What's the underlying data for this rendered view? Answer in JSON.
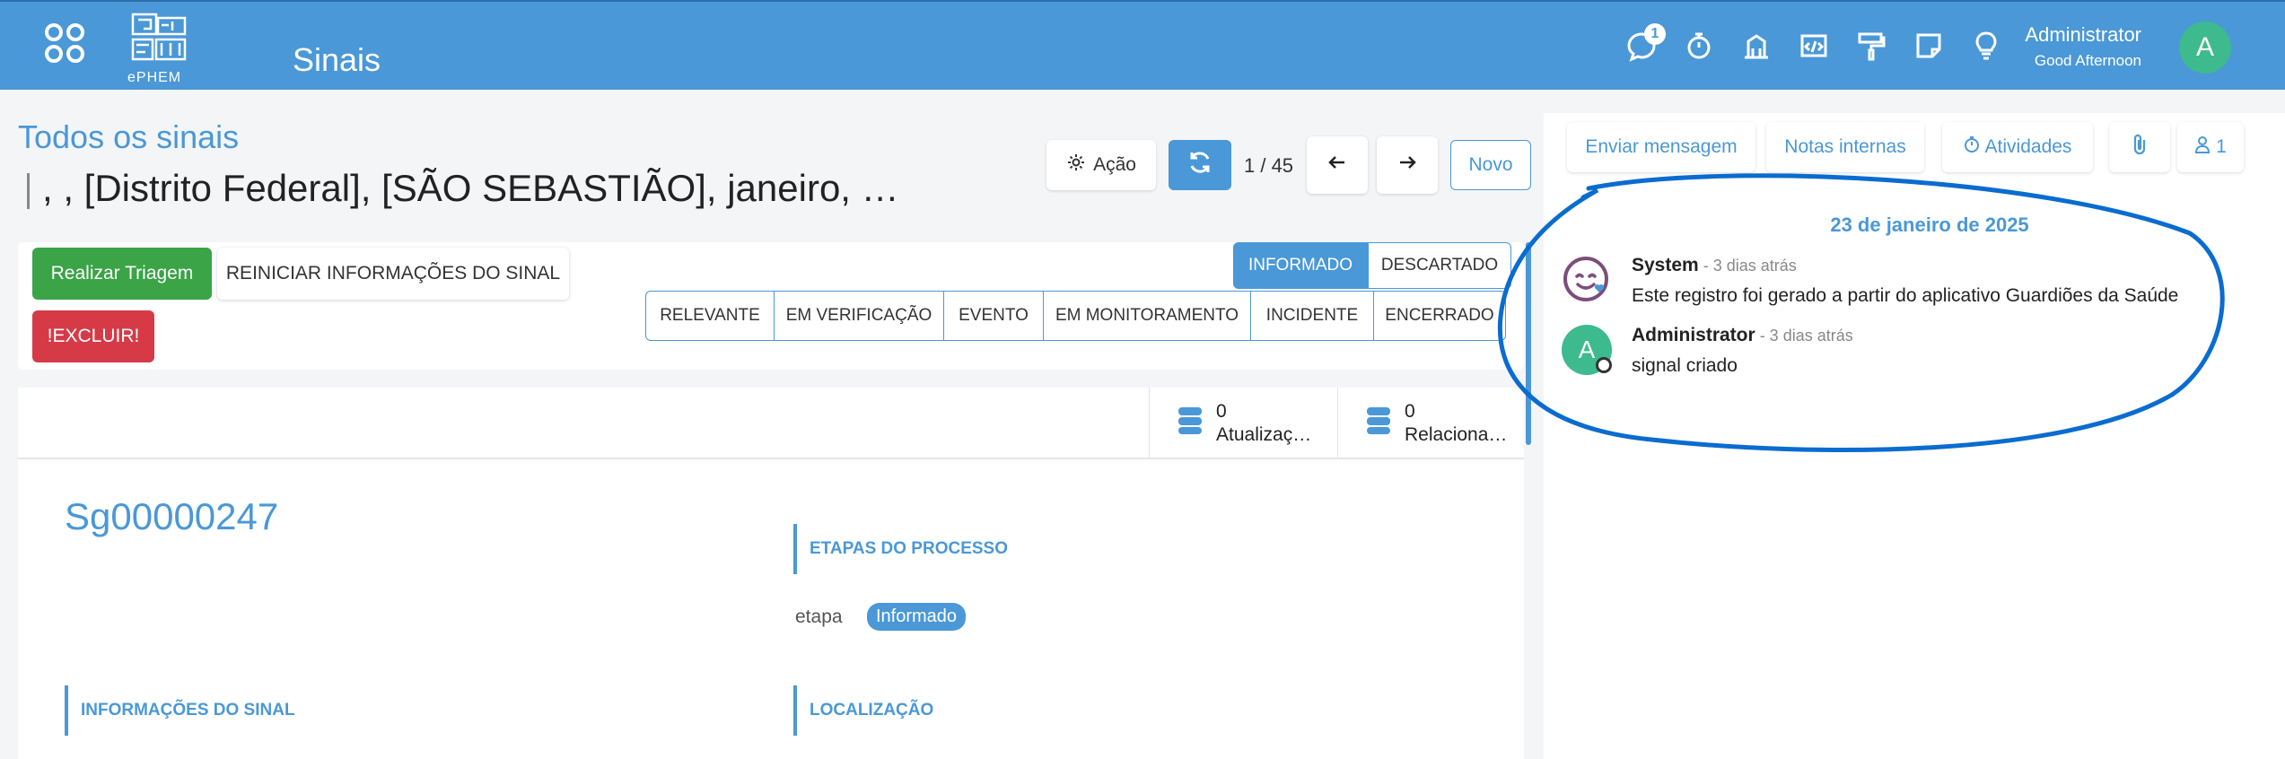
{
  "navbar": {
    "app_title": "Sinais",
    "logo_text": "ePHEM",
    "message_badge": "1",
    "user_name": "Administrator",
    "user_greeting": "Good Afternoon",
    "user_initial": "A",
    "icons": [
      "messages-icon",
      "stopwatch-icon",
      "building-icon",
      "code-window-icon",
      "paint-roller-icon",
      "note-icon",
      "lightbulb-icon"
    ]
  },
  "control": {
    "breadcrumb": "Todos os sinais",
    "record_title": ", , [Distrito Federal], [SÃO SEBASTIÃO], janeiro, …",
    "action_label": "Ação",
    "pager": "1 / 45",
    "new_label": "Novo"
  },
  "form": {
    "triage_label": "Realizar Triagem",
    "reset_label": "REINICIAR INFORMAÇÕES DO SINAL",
    "delete_label": "!EXCLUIR!",
    "status_top": [
      {
        "label": "INFORMADO",
        "active": true
      },
      {
        "label": "DESCARTADO",
        "active": false
      }
    ],
    "status_bottom": [
      "RELEVANTE",
      "EM VERIFICAÇÃO",
      "EVENTO",
      "EM MONITORAMENTO",
      "INCIDENTE",
      "ENCERRADO"
    ],
    "smart_buttons": [
      {
        "count": "0",
        "label": "Atualizaç…"
      },
      {
        "count": "0",
        "label": "Relaciona…"
      }
    ],
    "reference": "Sg00000247",
    "sections": {
      "process_steps": "ETAPAS DO PROCESSO",
      "signal_info": "INFORMAÇÕES DO SINAL",
      "location": "LOCALIZAÇÃO"
    },
    "stage_label": "etapa",
    "stage_value": "Informado"
  },
  "chatter": {
    "send_message": "Enviar mensagem",
    "internal_notes": "Notas internas",
    "activities": "Atividades",
    "followers_count": "1",
    "date_separator": "23 de janeiro de 2025",
    "messages": [
      {
        "author": "System",
        "time": " - 3 dias atrás",
        "body": "Este registro foi gerado a partir do aplicativo Guardiões da Saúde"
      },
      {
        "author": "Administrator",
        "time": " - 3 dias atrás",
        "body": "signal criado",
        "initial": "A"
      }
    ]
  },
  "colors": {
    "brand": "#4a98d7",
    "success": "#3aa447",
    "danger": "#d63a47",
    "avatar": "#3dba8e",
    "annotation": "#0a6ccf"
  }
}
